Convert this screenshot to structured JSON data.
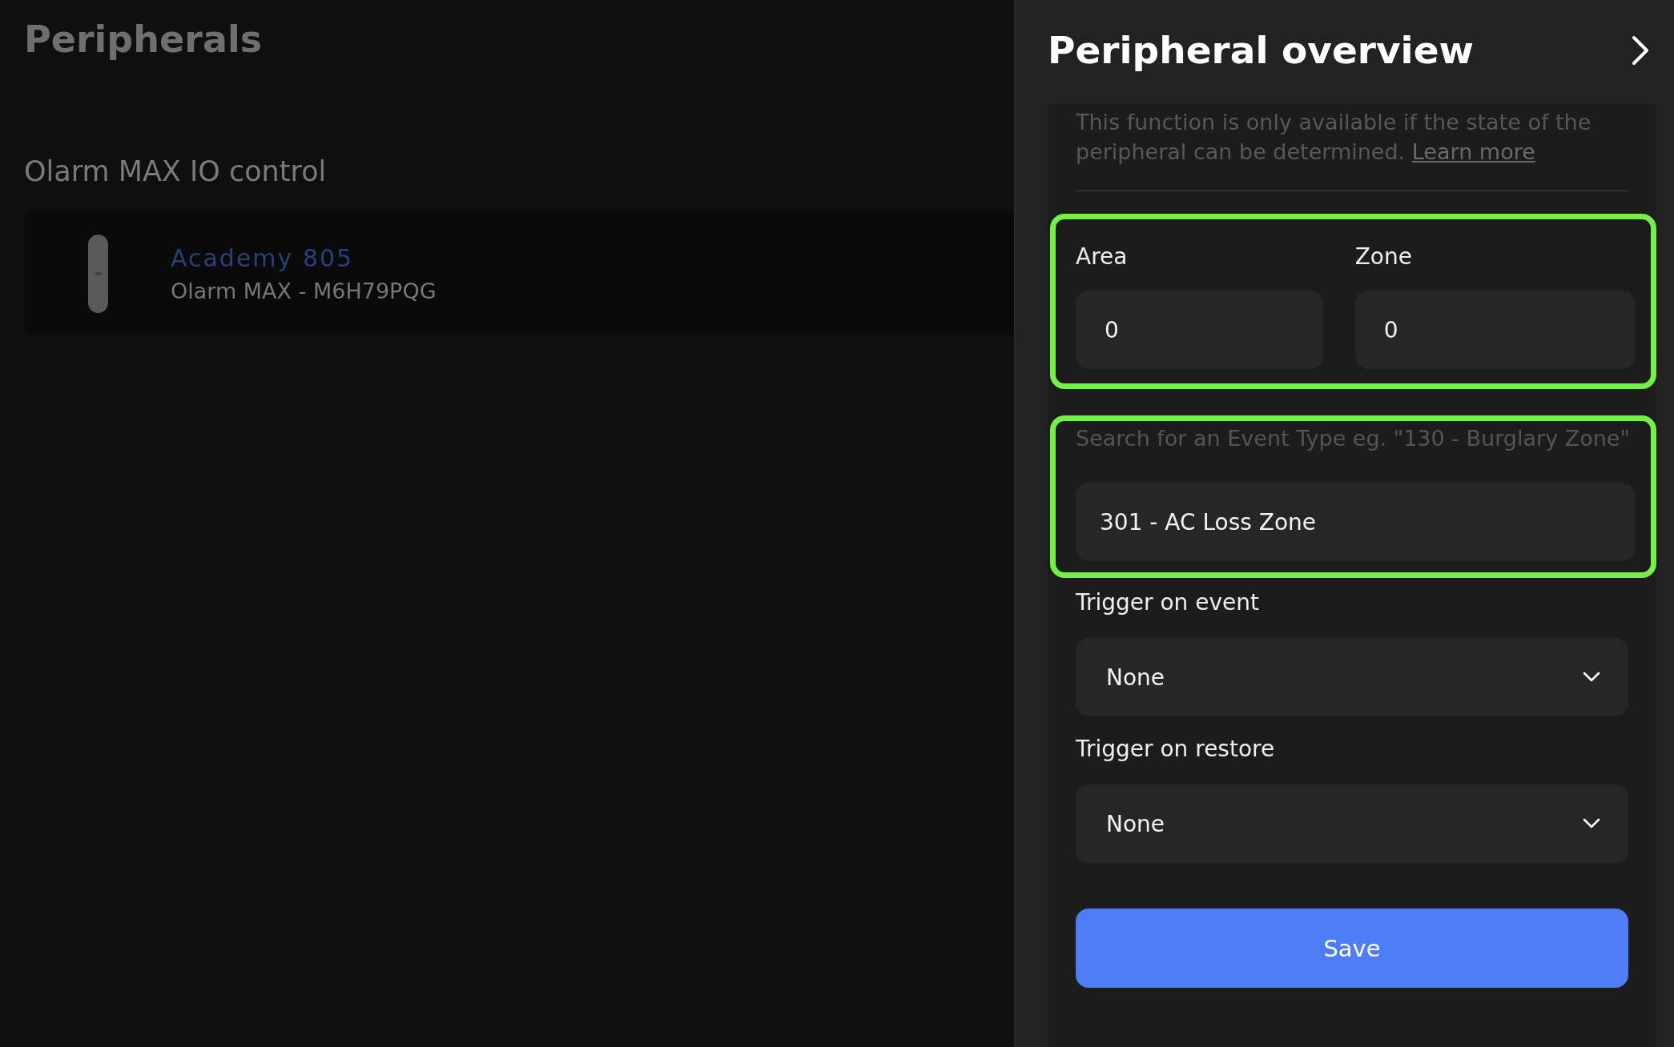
{
  "page": {
    "title": "Peripherals",
    "section_title": "Olarm MAX IO control"
  },
  "devices": [
    {
      "name": "Academy 805",
      "subtitle": "Olarm MAX - M6H79PQG"
    }
  ],
  "panel": {
    "title": "Peripheral overview",
    "info_text": "This function is only available if the state of the peripheral can be determined.",
    "info_link": "Learn more",
    "area": {
      "label": "Area",
      "value": "0"
    },
    "zone": {
      "label": "Zone",
      "value": "0"
    },
    "event_search": {
      "label": "Search for an Event Type eg. \"130 - Burglary Zone\"",
      "value": "301 - AC Loss Zone"
    },
    "selects": [
      {
        "label": "Trigger on event",
        "value": "None"
      },
      {
        "label": "Trigger on restore",
        "value": "None"
      }
    ],
    "save_button": "Save"
  }
}
